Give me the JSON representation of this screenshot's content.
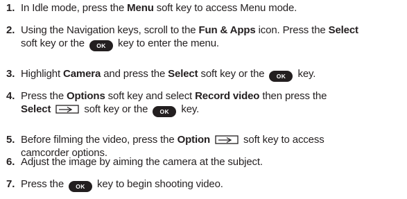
{
  "ok_label": "OK",
  "steps": [
    {
      "number": "1.",
      "lines": [
        [
          {
            "t": "text",
            "v": "In Idle mode, press the "
          },
          {
            "t": "bold",
            "v": "Menu"
          },
          {
            "t": "text",
            "v": " soft key to access Menu mode."
          }
        ]
      ]
    },
    {
      "number": "2.",
      "lines": [
        [
          {
            "t": "text",
            "v": "Using the Navigation keys, scroll to the "
          },
          {
            "t": "bold",
            "v": "Fun & Apps"
          },
          {
            "t": "text",
            "v": " icon. Press the "
          },
          {
            "t": "bold",
            "v": "Select"
          }
        ],
        [
          {
            "t": "text",
            "v": "soft key or the "
          },
          {
            "t": "ok"
          },
          {
            "t": "text",
            "v": " key to enter the menu."
          }
        ]
      ]
    },
    {
      "number": "3.",
      "lines": [
        [
          {
            "t": "text",
            "v": "Highlight "
          },
          {
            "t": "bold",
            "v": "Camera"
          },
          {
            "t": "text",
            "v": " and press the "
          },
          {
            "t": "bold",
            "v": "Select"
          },
          {
            "t": "text",
            "v": " soft key or the "
          },
          {
            "t": "ok"
          },
          {
            "t": "text",
            "v": " key."
          }
        ]
      ]
    },
    {
      "number": "4.",
      "lines": [
        [
          {
            "t": "text",
            "v": "Press the "
          },
          {
            "t": "bold",
            "v": "Options"
          },
          {
            "t": "text",
            "v": " soft key and select "
          },
          {
            "t": "bold",
            "v": "Record video"
          },
          {
            "t": "text",
            "v": " then press the"
          }
        ],
        [
          {
            "t": "bold",
            "v": "Select"
          },
          {
            "t": "text",
            "v": " "
          },
          {
            "t": "softkey"
          },
          {
            "t": "text",
            "v": " soft key or the "
          },
          {
            "t": "ok"
          },
          {
            "t": "text",
            "v": " key."
          }
        ]
      ]
    },
    {
      "number": "5.",
      "lines": [
        [
          {
            "t": "text",
            "v": "Before filming the video, press the "
          },
          {
            "t": "bold",
            "v": "Option"
          },
          {
            "t": "text",
            "v": " "
          },
          {
            "t": "softkey"
          },
          {
            "t": "text",
            "v": " soft key to access"
          }
        ],
        [
          {
            "t": "text",
            "v": "camcorder options."
          }
        ]
      ]
    },
    {
      "number": "6.",
      "lines": [
        [
          {
            "t": "text",
            "v": "Adjust the image by aiming the camera at the subject."
          }
        ]
      ]
    },
    {
      "number": "7.",
      "lines": [
        [
          {
            "t": "text",
            "v": "Press the "
          },
          {
            "t": "ok"
          },
          {
            "t": "text",
            "v": " key to begin shooting video."
          }
        ]
      ]
    }
  ]
}
